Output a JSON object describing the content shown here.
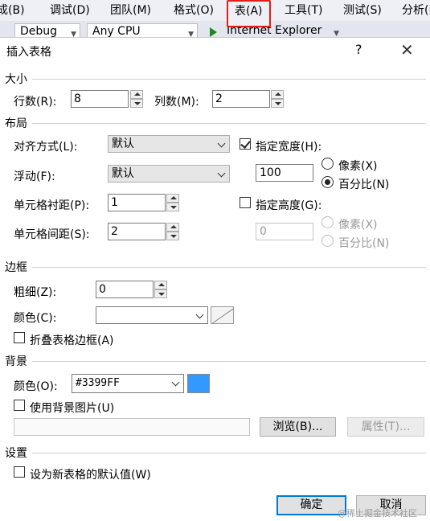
{
  "menubar": {
    "items": [
      "成(B)",
      "调试(D)",
      "团队(M)",
      "格式(O)",
      "表(A)",
      "工具(T)",
      "测试(S)",
      "分析(N"
    ]
  },
  "toolbar": {
    "config": "Debug",
    "platform": "Any CPU",
    "browser": "Internet Explorer"
  },
  "dialog": {
    "title": "插入表格",
    "help": "?",
    "close": "✕",
    "size": {
      "section": "大小",
      "rows_label": "行数(R):",
      "rows_value": "8",
      "cols_label": "列数(M):",
      "cols_value": "2"
    },
    "layout": {
      "section": "布局",
      "align_label": "对齐方式(L):",
      "align_value": "默认",
      "float_label": "浮动(F):",
      "float_value": "默认",
      "padding_label": "单元格衬距(P):",
      "padding_value": "1",
      "spacing_label": "单元格间距(S):",
      "spacing_value": "2",
      "width_check_label": "指定宽度(H):",
      "width_checked": true,
      "width_value": "100",
      "width_px": "像素(X)",
      "width_pct": "百分比(N)",
      "width_unit_selected": "percent",
      "height_check_label": "指定高度(G):",
      "height_checked": false,
      "height_value": "0",
      "height_px": "像素(X)",
      "height_pct": "百分比(N)"
    },
    "border": {
      "section": "边框",
      "size_label": "粗细(Z):",
      "size_value": "0",
      "color_label": "颜色(C):",
      "color_value": "",
      "collapse_label": "折叠表格边框(A)",
      "collapse_checked": false
    },
    "background": {
      "section": "背景",
      "color_label": "颜色(O):",
      "color_value": "#3399FF",
      "swatch_color": "#3399FF",
      "use_image_label": "使用背景图片(U)",
      "use_image_checked": false,
      "image_path": "",
      "browse_label": "浏览(B)...",
      "properties_label": "属性(T)..."
    },
    "settings": {
      "section": "设置",
      "default_label": "设为新表格的默认值(W)",
      "default_checked": false
    },
    "ok_label": "确定",
    "cancel_label": "取消"
  },
  "watermark": "@稀土掘金技术社区"
}
